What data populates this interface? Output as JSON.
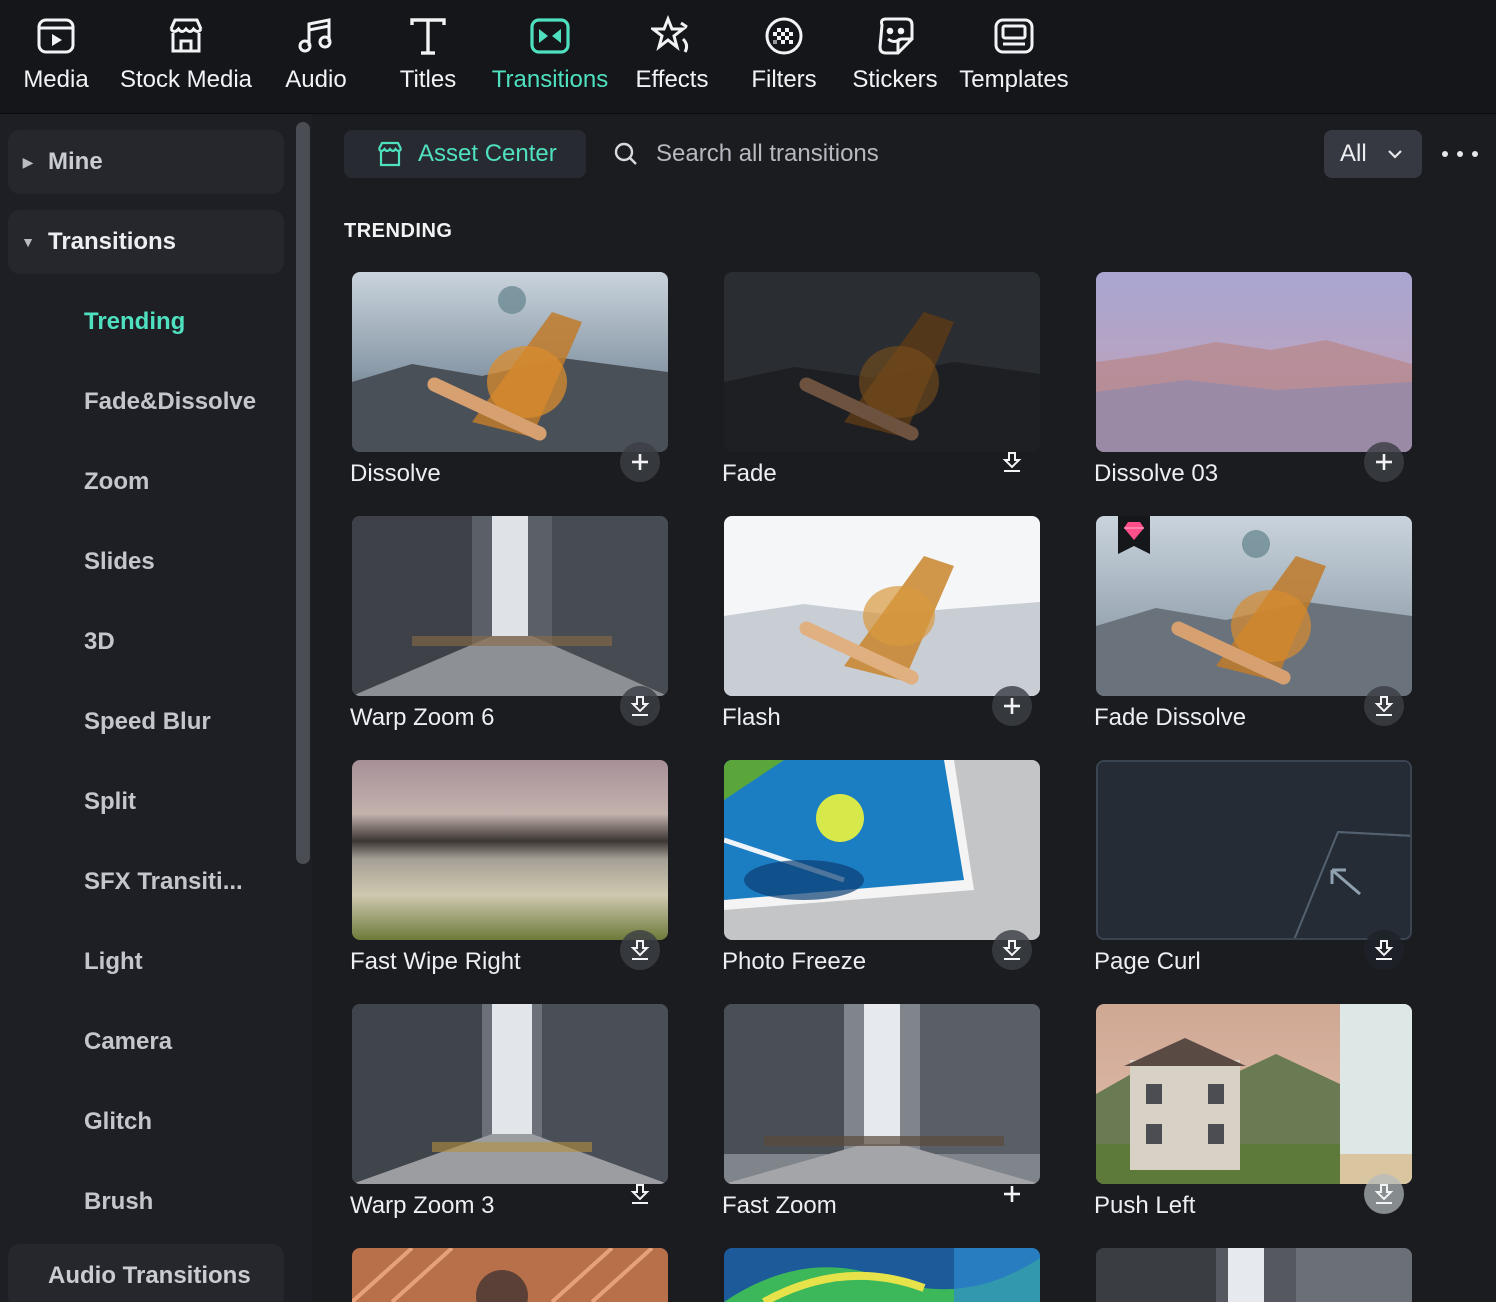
{
  "toolbar": {
    "items": [
      {
        "label": "Media",
        "icon": "media-icon"
      },
      {
        "label": "Stock Media",
        "icon": "stock-media-icon"
      },
      {
        "label": "Audio",
        "icon": "audio-note-icon"
      },
      {
        "label": "Titles",
        "icon": "titles-t-icon"
      },
      {
        "label": "Transitions",
        "icon": "transitions-icon"
      },
      {
        "label": "Effects",
        "icon": "effects-star-icon"
      },
      {
        "label": "Filters",
        "icon": "filters-icon"
      },
      {
        "label": "Stickers",
        "icon": "stickers-icon"
      },
      {
        "label": "Templates",
        "icon": "templates-icon"
      }
    ],
    "active": "Transitions"
  },
  "sidebar": {
    "groups": [
      {
        "label": "Mine",
        "expanded": false
      },
      {
        "label": "Transitions",
        "expanded": true
      },
      {
        "label": "Audio Transitions",
        "expanded": false
      }
    ],
    "items": [
      {
        "label": "Trending",
        "active": true
      },
      {
        "label": "Fade&Dissolve"
      },
      {
        "label": "Zoom"
      },
      {
        "label": "Slides"
      },
      {
        "label": "3D"
      },
      {
        "label": "Speed Blur"
      },
      {
        "label": "Split"
      },
      {
        "label": "SFX Transiti..."
      },
      {
        "label": "Light"
      },
      {
        "label": "Camera"
      },
      {
        "label": "Glitch"
      },
      {
        "label": "Brush"
      }
    ]
  },
  "main": {
    "asset_center_label": "Asset Center",
    "search": {
      "placeholder": "Search all transitions",
      "value": ""
    },
    "filter": {
      "selected": "All"
    },
    "section_title": "TRENDING",
    "cards": [
      {
        "name": "Dissolve",
        "action": "add",
        "premium": false
      },
      {
        "name": "Fade",
        "action": "download",
        "premium": false
      },
      {
        "name": "Dissolve 03",
        "action": "add",
        "premium": false
      },
      {
        "name": "Warp Zoom 6",
        "action": "download",
        "premium": false
      },
      {
        "name": "Flash",
        "action": "add",
        "premium": false
      },
      {
        "name": "Fade Dissolve",
        "action": "download",
        "premium": true
      },
      {
        "name": "Fast Wipe Right",
        "action": "download",
        "premium": false
      },
      {
        "name": "Photo Freeze",
        "action": "download",
        "premium": false
      },
      {
        "name": "Page Curl",
        "action": "download",
        "premium": false
      },
      {
        "name": "Warp Zoom 3",
        "action": "download",
        "premium": false
      },
      {
        "name": "Fast Zoom",
        "action": "add",
        "premium": false
      },
      {
        "name": "Push Left",
        "action": "download",
        "premium": false
      }
    ]
  },
  "colors": {
    "accent": "#4fe0c0",
    "background": "#1b1c20",
    "toolbar_bg": "#14161a",
    "sidebar_bg": "#1d1f24"
  }
}
